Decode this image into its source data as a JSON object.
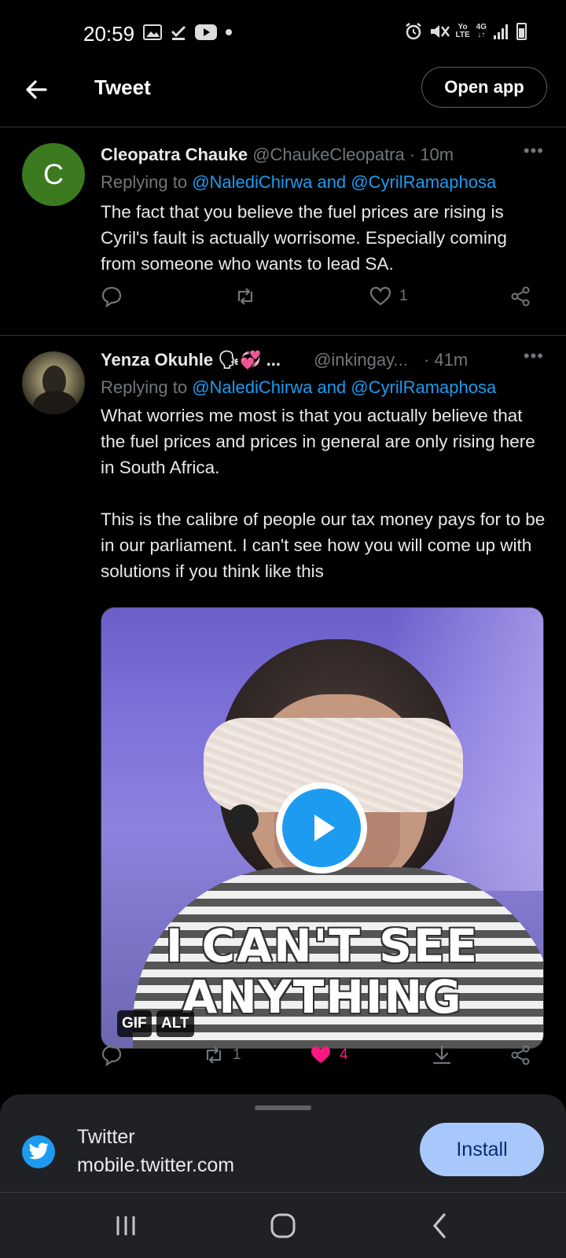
{
  "status_bar": {
    "time": "20:59",
    "left_icons": [
      "gallery-icon",
      "download-done-icon",
      "youtube-icon",
      "dot-icon"
    ],
    "right_icons": [
      "alarm-icon",
      "mute-icon",
      "volte-icon",
      "4g-icon",
      "signal-icon",
      "battery-icon"
    ],
    "volte_top": "Yo",
    "volte_bottom": "LTE",
    "net_top": "4G",
    "net_bottom": "↓↑"
  },
  "header": {
    "title": "Tweet",
    "open_app_label": "Open app"
  },
  "tweets": [
    {
      "avatar_letter": "C",
      "display_name": "Cleopatra Chauke",
      "handle": "@ChaukeCleopatra",
      "time": "· 10m",
      "more": "•••",
      "replying_prefix": "Replying to ",
      "replying_to": "@NalediChirwa and @CyrilRamaphosa",
      "text": "The fact that you believe the fuel prices are rising is Cyril's fault is actually worrisome. Especially coming from someone who wants to lead SA.",
      "actions": {
        "replies": "",
        "retweets": "",
        "likes": "1"
      }
    },
    {
      "display_name": "Yenza Okuhle 🗣💞 ...",
      "handle": "@inkingay...",
      "time": "· 41m",
      "more": "•••",
      "replying_prefix": "Replying to ",
      "replying_to": "@NalediChirwa and @CyrilRamaphosa",
      "text": "What worries me most is that you actually believe that the fuel prices and prices in general are only rising here in South Africa.\n\nThis is the calibre of people our tax money pays for to be in our parliament. I can't see how you will come up with solutions if you think like this",
      "media": {
        "caption_line1": "I CAN'T SEE",
        "caption_line2": "ANYTHING",
        "badge_gif": "GIF",
        "badge_alt": "ALT"
      },
      "actions": {
        "replies": "",
        "retweets": "1",
        "likes": "4"
      }
    }
  ],
  "install_sheet": {
    "app_name": "Twitter",
    "url": "mobile.twitter.com",
    "install_label": "Install"
  },
  "colors": {
    "background": "#000000",
    "accent_blue": "#1d9bf0",
    "like_pink": "#f91880",
    "muted_text": "#71767b"
  }
}
